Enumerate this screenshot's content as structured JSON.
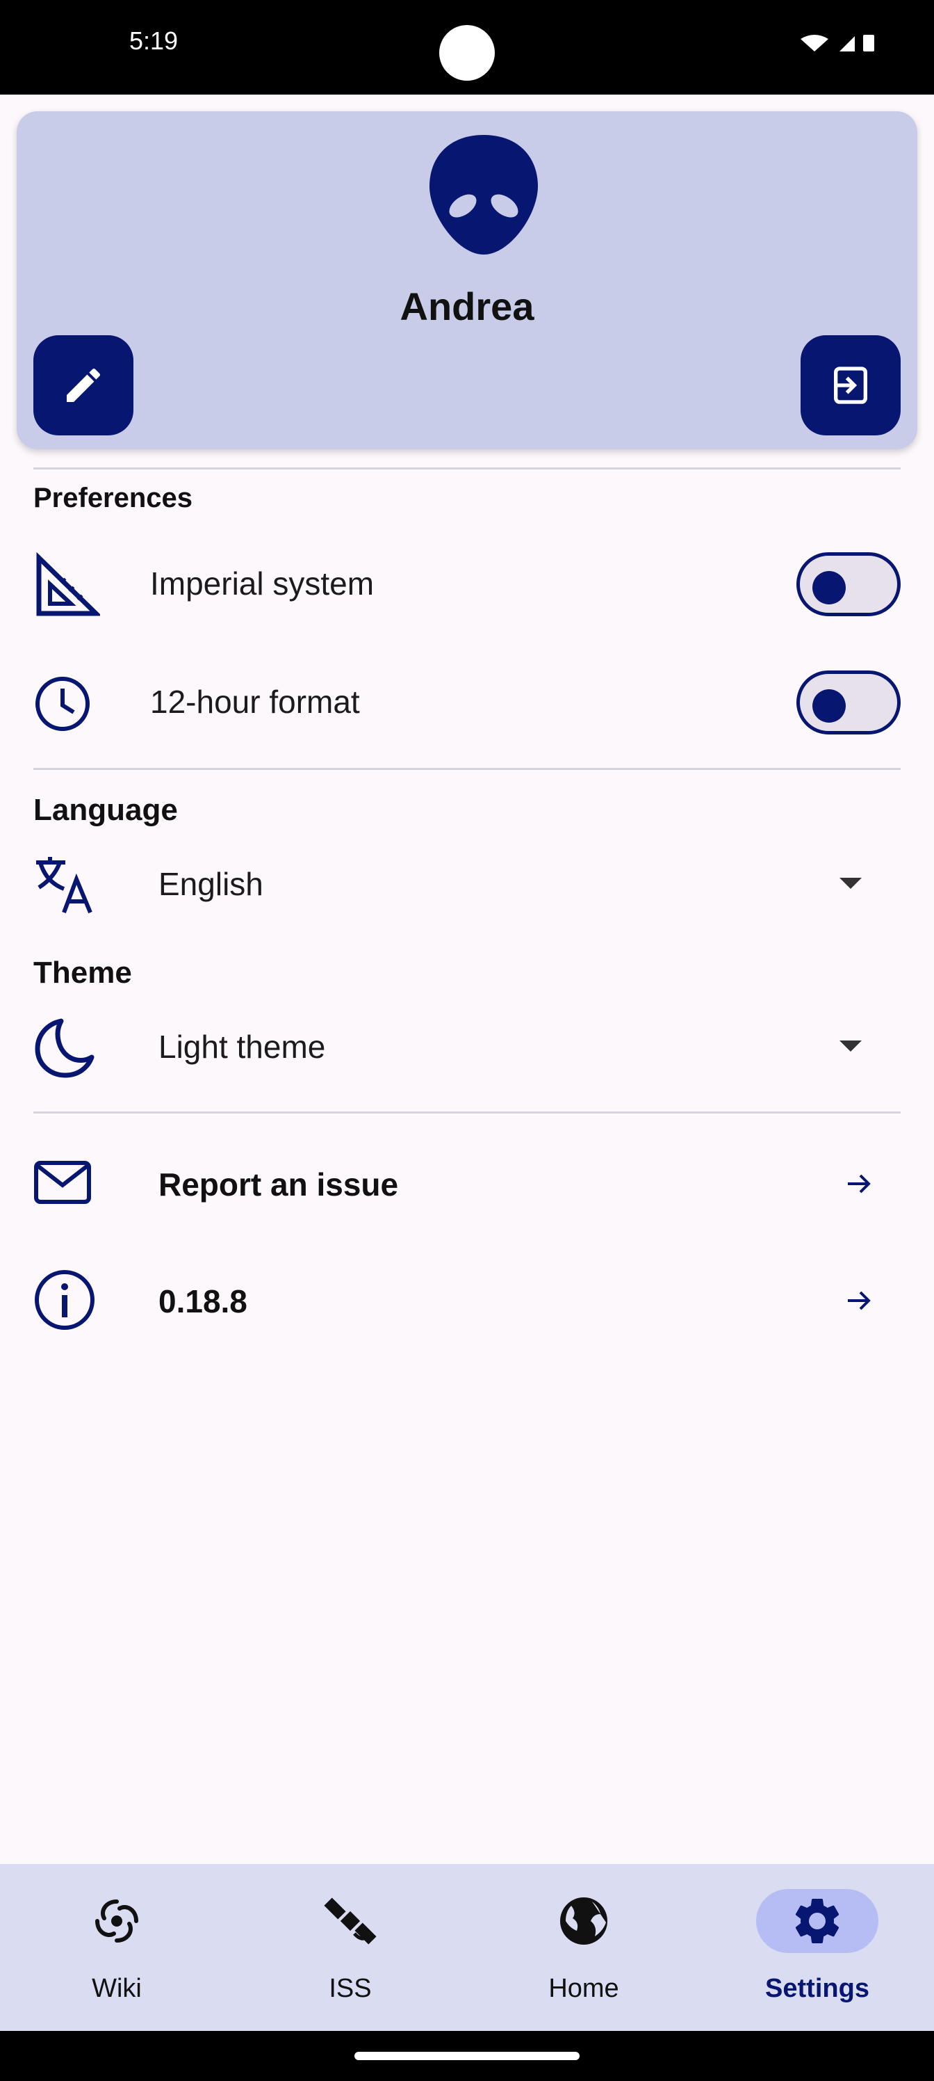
{
  "status_bar": {
    "time": "5:19"
  },
  "profile": {
    "name": "Andrea"
  },
  "preferences": {
    "title": "Preferences",
    "imperial": {
      "label": "Imperial system",
      "enabled": false
    },
    "hour12": {
      "label": "12-hour format",
      "enabled": false
    }
  },
  "language": {
    "title": "Language",
    "value": "English"
  },
  "theme": {
    "title": "Theme",
    "value": "Light theme"
  },
  "links": {
    "report": "Report an issue",
    "version": "0.18.8"
  },
  "nav": {
    "items": [
      {
        "label": "Wiki",
        "icon": "galaxy-icon",
        "active": false
      },
      {
        "label": "ISS",
        "icon": "satellite-icon",
        "active": false
      },
      {
        "label": "Home",
        "icon": "globe-icon",
        "active": false
      },
      {
        "label": "Settings",
        "icon": "gear-icon",
        "active": true
      }
    ]
  },
  "colors": {
    "accent": "#071670",
    "card": "#c8cce8",
    "nav": "#dadcf2",
    "active_pill": "#b6bdf4"
  }
}
